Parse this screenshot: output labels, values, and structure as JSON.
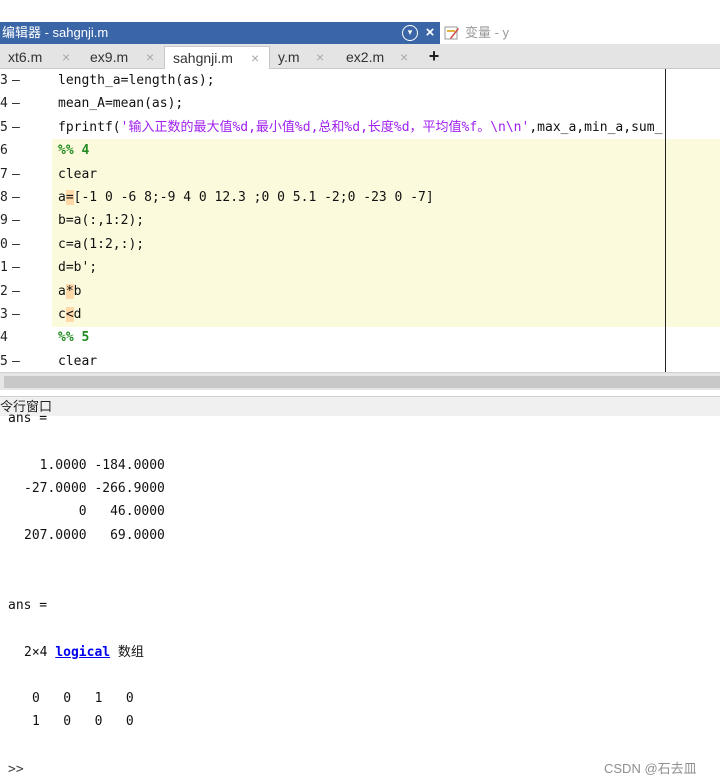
{
  "editor": {
    "title": "编辑器 - sahgnji.m",
    "variables_tab": "变量 - y",
    "tabs": [
      "xt6.m",
      "ex9.m",
      "sahgnji.m",
      "y.m",
      "ex2.m"
    ],
    "add_tab_label": "+",
    "close_glyph": "×",
    "active_tab": "sahgnji.m"
  },
  "code_lines": [
    {
      "num": "3",
      "dash": "—",
      "text": "length_a=length(as);"
    },
    {
      "num": "4",
      "dash": "—",
      "text": "mean_A=mean(as);"
    },
    {
      "num": "5",
      "dash": "—",
      "prefix": "fprintf(",
      "string": "'输入正数的最大值%d,最小值%d,总和%d,长度%d，平均值%f。\\n\\n'",
      "suffix": ",max_a,min_a,sum_"
    },
    {
      "num": "6",
      "dash": "",
      "section": "%% 4"
    },
    {
      "num": "7",
      "dash": "—",
      "text": "clear"
    },
    {
      "num": "8",
      "dash": "—",
      "before": "a",
      "marked": "=",
      "after": "[-1 0 -6 8;-9 4 0 12.3 ;0 0 5.1 -2;0 -23 0 -7]"
    },
    {
      "num": "9",
      "dash": "—",
      "text": "b=a(:,1:2);"
    },
    {
      "num": "0",
      "dash": "—",
      "text": "c=a(1:2,:);"
    },
    {
      "num": "1",
      "dash": "—",
      "text": "d=b';"
    },
    {
      "num": "2",
      "dash": "—",
      "before": "a",
      "marked": "*",
      "after": "b"
    },
    {
      "num": "3",
      "dash": "—",
      "before": "c",
      "marked": "<",
      "after": "d"
    },
    {
      "num": "4",
      "dash": "",
      "section": "%% 5"
    },
    {
      "num": "5",
      "dash": "—",
      "text": "clear"
    }
  ],
  "command_window": {
    "title": "令行窗口",
    "ans1_label": "ans =",
    "matrix1": [
      "  1.0000 -184.0000",
      "-27.0000 -266.9000",
      "       0   46.0000",
      "207.0000   69.0000"
    ],
    "ans2_label": "ans =",
    "size_prefix": "2×4 ",
    "type_link": "logical",
    "size_suffix": " 数组",
    "logical_rows": [
      "0   0   1   0",
      "1   0   0   0"
    ],
    "prompt": ">>"
  },
  "watermark": "CSDN @石去皿",
  "colors": {
    "title_bar": "#3a66a8",
    "cell_highlight": "#fcfadc",
    "string": "#a020f0",
    "section": "#228b22",
    "link": "#0000ee"
  }
}
